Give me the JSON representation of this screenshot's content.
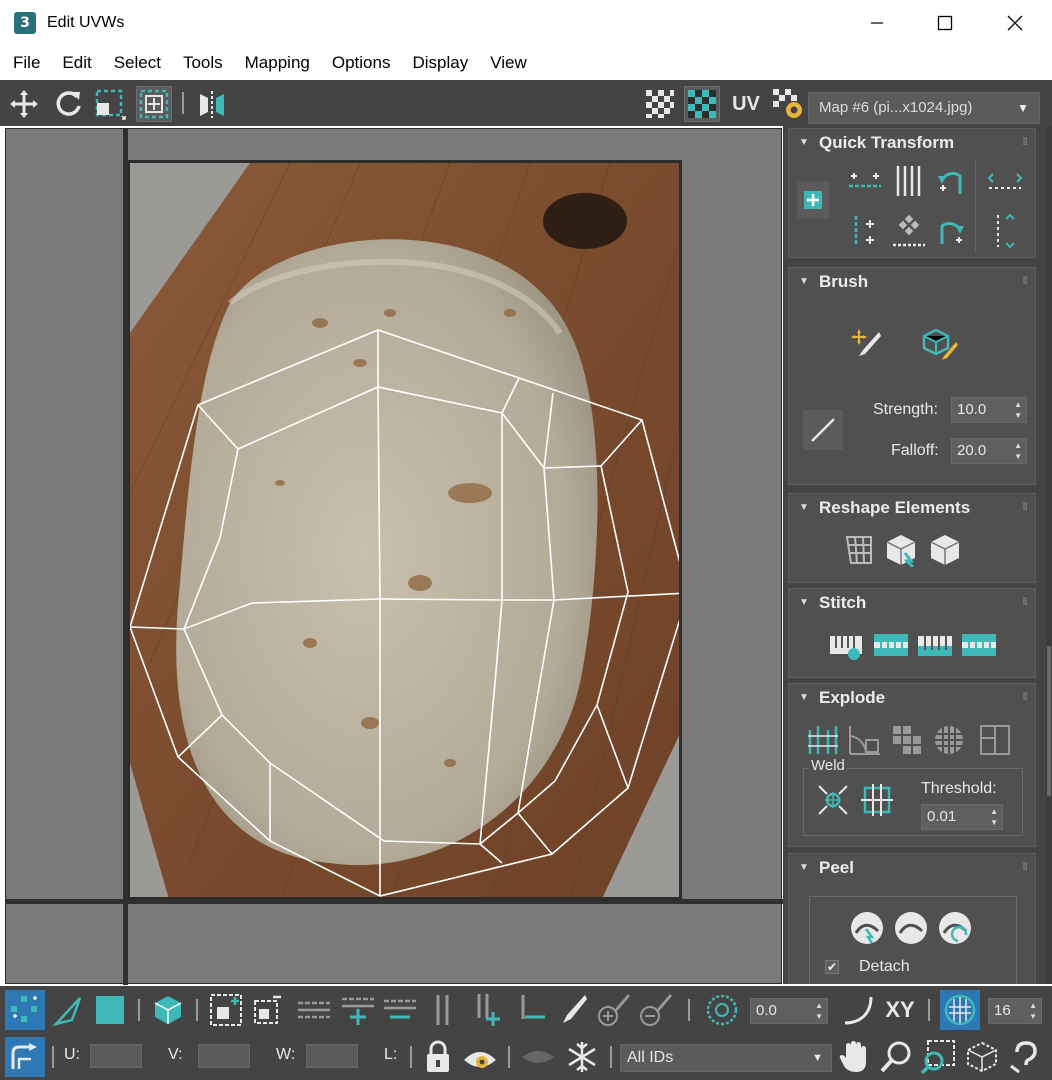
{
  "window": {
    "title": "Edit UVWs",
    "app_icon_text": "3"
  },
  "menu": [
    "File",
    "Edit",
    "Select",
    "Tools",
    "Mapping",
    "Options",
    "Display",
    "View"
  ],
  "toolbar": {
    "uv_label": "UV",
    "map_selector": "Map #6 (pi...x1024.jpg)"
  },
  "rollouts": {
    "quick_transform": "Quick Transform",
    "brush": {
      "title": "Brush",
      "strength_label": "Strength:",
      "strength_value": "10.0",
      "falloff_label": "Falloff:",
      "falloff_value": "20.0"
    },
    "reshape": "Reshape Elements",
    "stitch": "Stitch",
    "explode": {
      "title": "Explode",
      "weld_label": "Weld",
      "threshold_label": "Threshold:",
      "threshold_value": "0.01"
    },
    "peel": {
      "title": "Peel",
      "detach_label": "Detach"
    }
  },
  "bottom": {
    "angle_value": "0.0",
    "xy_label": "XY",
    "grid_value": "16",
    "u_label": "U:",
    "v_label": "V:",
    "w_label": "W:",
    "l_label": "L:",
    "ids_select": "All IDs"
  },
  "colors": {
    "accent": "#3fb9b8",
    "panel_bg": "#444444",
    "rollout_bg": "#505050",
    "viewport_bg": "#7a7a7a"
  }
}
